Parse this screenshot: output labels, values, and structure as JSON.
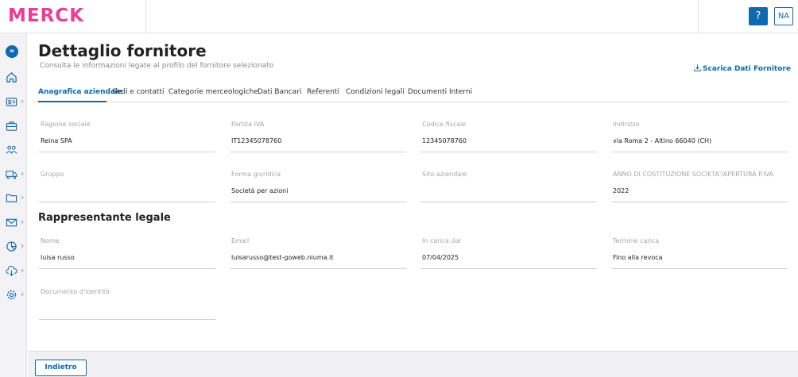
{
  "header": {
    "logo_text": "MERCK",
    "help_label": "?",
    "user_initials": "NA"
  },
  "sidebar": {
    "items": [
      {
        "icon": "expand-icon"
      },
      {
        "icon": "home-icon"
      },
      {
        "icon": "id-card-icon"
      },
      {
        "icon": "briefcase-icon"
      },
      {
        "icon": "users-icon"
      },
      {
        "icon": "truck-icon"
      },
      {
        "icon": "folder-icon"
      },
      {
        "icon": "mail-icon"
      },
      {
        "icon": "pie-chart-icon"
      },
      {
        "icon": "cloud-download-icon"
      },
      {
        "icon": "settings-icon"
      }
    ]
  },
  "page": {
    "title": "Dettaglio fornitore",
    "subtitle": "Consulta le informazioni legate al profilo del fornitore selezionato",
    "download_label": "Scarica Dati Fornitore"
  },
  "tabs": [
    {
      "label": "Anagrafica aziendale",
      "active": true
    },
    {
      "label": "Sedi e contatti"
    },
    {
      "label": "Categorie merceologiche"
    },
    {
      "label": "Dati Bancari"
    },
    {
      "label": "Referenti"
    },
    {
      "label": "Condizioni legali"
    },
    {
      "label": "Documenti Interni"
    }
  ],
  "company": {
    "ragione_sociale": {
      "label": "Ragione sociale",
      "value": "Reina SPA"
    },
    "partita_iva": {
      "label": "Partita IVA",
      "value": "IT12345078760"
    },
    "codice_fiscale": {
      "label": "Codice fiscale",
      "value": "12345078760"
    },
    "indirizzo": {
      "label": "Indirizzo",
      "value": "via Roma 2 - Altino 66040 (CH)"
    },
    "gruppo": {
      "label": "Gruppo",
      "value": ""
    },
    "forma_giuridica": {
      "label": "Forma giuridica",
      "value": "Società per azioni"
    },
    "sito": {
      "label": "Sito aziendale",
      "value": ""
    },
    "anno": {
      "label": "ANNO DI COSTITUZIONE SOCIETA'/APERTURA P.IVA",
      "value": "2022"
    }
  },
  "legal_rep": {
    "title": "Rappresentante legale",
    "nome": {
      "label": "Nome",
      "value": "luisa russo"
    },
    "email": {
      "label": "Email",
      "value": "luisarusso@test-goweb.niuma.it"
    },
    "in_carica": {
      "label": "In carica dal",
      "value": "07/04/2025"
    },
    "termine": {
      "label": "Termine carica",
      "value": "Fino alla revoca"
    },
    "documento": {
      "label": "Documento d'identità",
      "value": ""
    }
  },
  "footer": {
    "back_label": "Indietro"
  },
  "colors": {
    "brand": "#eb3c96",
    "accent": "#0f69af"
  }
}
